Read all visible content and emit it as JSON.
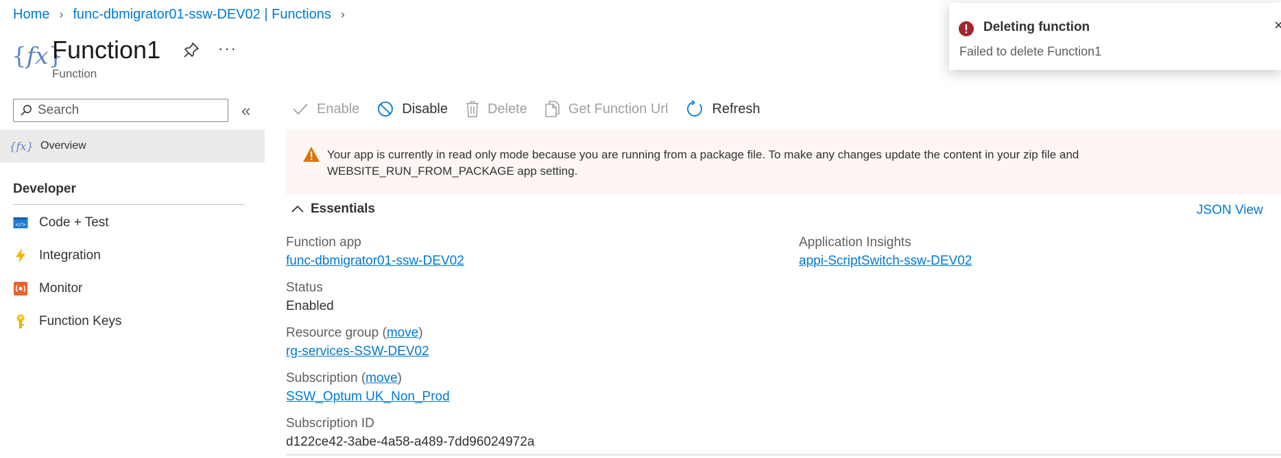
{
  "breadcrumb": {
    "home": "Home",
    "parent": "func-dbmigrator01-ssw-DEV02 | Functions",
    "separator": ">"
  },
  "header": {
    "title": "Function1",
    "subtitle": "Function",
    "more": "···"
  },
  "sidebar": {
    "search_placeholder": "Search",
    "collapse": "«",
    "overview_label": "Overview",
    "section_title": "Developer",
    "items": [
      {
        "label": "Code + Test",
        "icon": "code-test-icon"
      },
      {
        "label": "Integration",
        "icon": "lightning-icon"
      },
      {
        "label": "Monitor",
        "icon": "monitor-icon"
      },
      {
        "label": "Function Keys",
        "icon": "key-icon"
      }
    ]
  },
  "toolbar": {
    "enable": "Enable",
    "disable": "Disable",
    "delete": "Delete",
    "get_url": "Get Function Url",
    "refresh": "Refresh"
  },
  "banner": {
    "message": "Your app is currently in read only mode because you are running from a package file. To make any changes update the content in your zip file and WEBSITE_RUN_FROM_PACKAGE app setting."
  },
  "essentials": {
    "title": "Essentials",
    "json_view": "JSON View",
    "function_app_label": "Function app",
    "function_app_value": "func-dbmigrator01-ssw-DEV02",
    "status_label": "Status",
    "status_value": "Enabled",
    "resource_group_label": "Resource group",
    "resource_group_move": "move",
    "resource_group_value": "rg-services-SSW-DEV02",
    "subscription_label": "Subscription",
    "subscription_move": "move",
    "subscription_value": "SSW_Optum UK_Non_Prod",
    "subscription_id_label": "Subscription ID",
    "subscription_id_value": "d122ce42-3abe-4a58-a489-7dd96024972a",
    "app_insights_label": "Application Insights",
    "app_insights_value": "appi-ScriptSwitch-ssw-DEV02"
  },
  "toast": {
    "title": "Deleting function",
    "message": "Failed to delete Function1",
    "close": "×"
  },
  "colors": {
    "accent": "#0078d4",
    "error": "#a4262c",
    "warning": "#d83b01",
    "banner_bg": "#fdf6f2"
  }
}
